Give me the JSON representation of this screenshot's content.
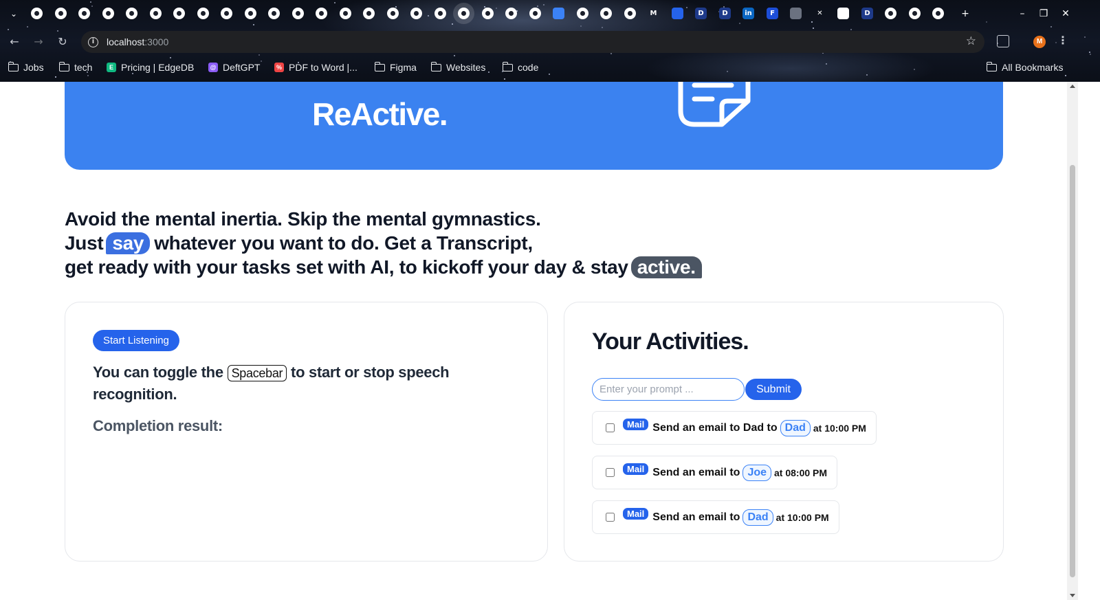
{
  "browser": {
    "url_host": "localhost",
    "url_port": ":3000",
    "profile_initial": "M",
    "tab_glyphs": [
      "M",
      "D",
      "D",
      "in",
      "F",
      "✕",
      "D"
    ],
    "bookmarks": [
      {
        "label": "Jobs",
        "type": "folder"
      },
      {
        "label": "tech",
        "type": "folder"
      },
      {
        "label": "Pricing | EdgeDB",
        "type": "site",
        "icon": "E",
        "color": "#10b981"
      },
      {
        "label": "DeftGPT",
        "type": "site",
        "icon": "@",
        "color": "#8b5cf6"
      },
      {
        "label": "PDF to Word |...",
        "type": "site",
        "icon": "%",
        "color": "#ef4444"
      },
      {
        "label": "Figma",
        "type": "folder"
      },
      {
        "label": "Websites",
        "type": "folder"
      },
      {
        "label": "code",
        "type": "folder"
      }
    ],
    "all_bookmarks": "All Bookmarks"
  },
  "hero": {
    "brand": "ReActive."
  },
  "tagline": {
    "line1": "Avoid the mental inertia. Skip the mental gymnastics.",
    "line2_before": "Just",
    "line2_bubble": "say",
    "line2_after": "whatever you want to do. Get a Transcript,",
    "line3_before": "get ready with your tasks set with AI, to kickoff your day & stay",
    "line3_bubble": "active."
  },
  "listener": {
    "start_button": "Start Listening",
    "hint_before": "You can toggle the",
    "hint_key": "Spacebar",
    "hint_after": "to start or stop speech recognition.",
    "completion_label": "Completion result:"
  },
  "activities": {
    "title": "Your Activities.",
    "prompt_placeholder": "Enter your prompt ...",
    "prompt_value": "",
    "submit_label": "Submit",
    "tasks": [
      {
        "badge": "Mail",
        "text": "Send an email to Dad to",
        "person": "Dad",
        "time": "at 10:00 PM",
        "checked": false
      },
      {
        "badge": "Mail",
        "text": "Send an email to",
        "person": "Joe",
        "time": "at 08:00 PM",
        "checked": false
      },
      {
        "badge": "Mail",
        "text": "Send an email to",
        "person": "Dad",
        "time": "at 10:00 PM",
        "checked": false
      }
    ]
  },
  "colors": {
    "hero_blue": "#3b82f0",
    "primary_button": "#2563eb",
    "say_bubble": "#3b6fe0",
    "active_bubble": "#4b5563"
  }
}
